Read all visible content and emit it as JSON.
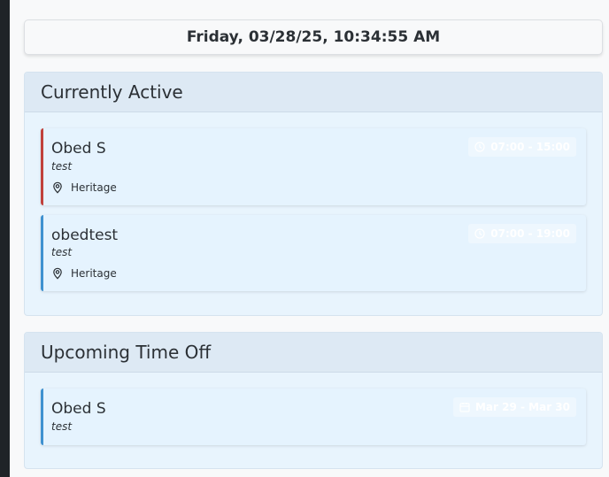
{
  "datetime": "Friday, 03/28/25, 10:34:55 AM",
  "active": {
    "title": "Currently Active",
    "cards": [
      {
        "name": "Obed S",
        "note": "test",
        "location": "Heritage",
        "time": "07:00 - 15:00",
        "accent": "#c0413c",
        "icon": "clock-icon"
      },
      {
        "name": "obedtest",
        "note": "test",
        "location": "Heritage",
        "time": "07:00 - 19:00",
        "accent": "#3e91d0",
        "icon": "clock-icon"
      }
    ]
  },
  "timeoff": {
    "title": "Upcoming Time Off",
    "cards": [
      {
        "name": "Obed S",
        "note": "test",
        "dates": "Mar 29 - Mar 30",
        "accent": "#3e91d0",
        "icon": "calendar-icon"
      }
    ]
  },
  "icons": {
    "location": "map-pin-icon"
  },
  "colors": {
    "panel_bg": "#e8f4fd",
    "header_bg": "#dde9f4",
    "page_bg": "#f8f9fa"
  }
}
